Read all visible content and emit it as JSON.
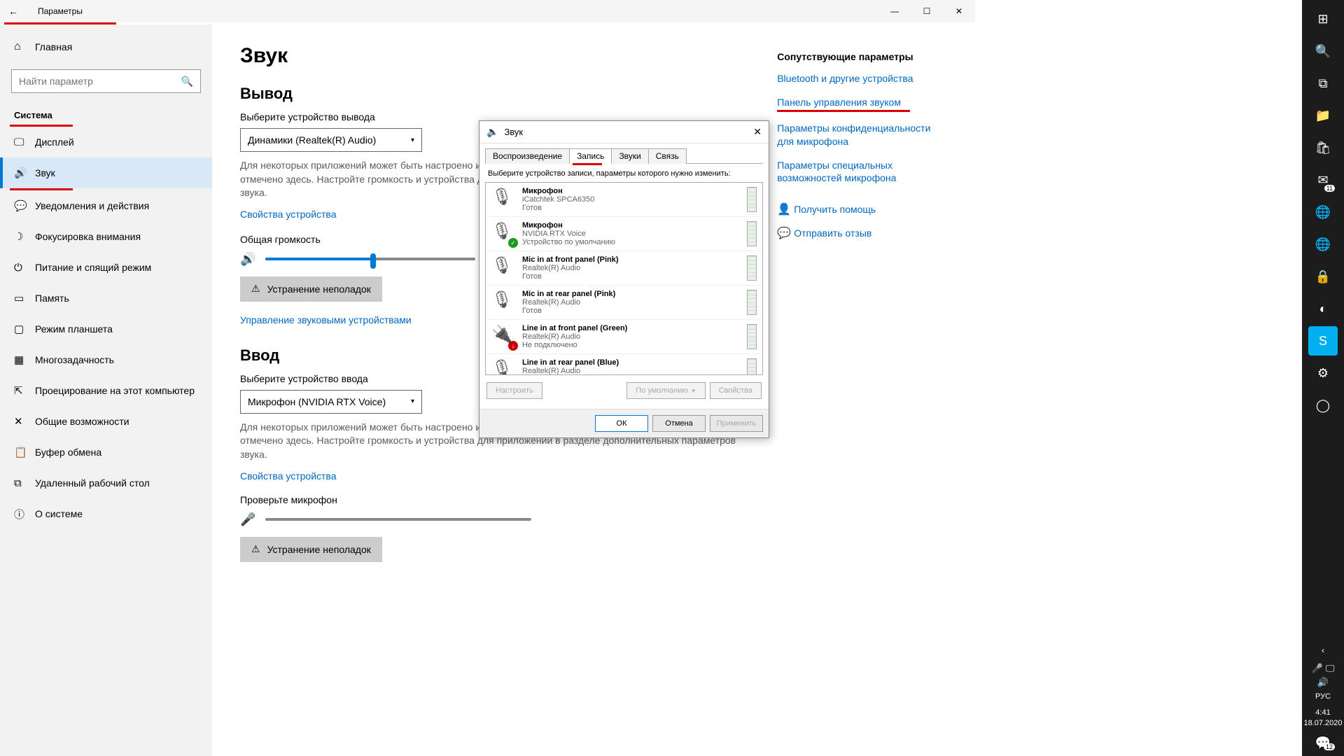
{
  "titlebar": {
    "title": "Параметры"
  },
  "sidebar": {
    "home": "Главная",
    "search_placeholder": "Найти параметр",
    "section": "Система",
    "items": [
      {
        "label": "Дисплей"
      },
      {
        "label": "Звук"
      },
      {
        "label": "Уведомления и действия"
      },
      {
        "label": "Фокусировка внимания"
      },
      {
        "label": "Питание и спящий режим"
      },
      {
        "label": "Память"
      },
      {
        "label": "Режим планшета"
      },
      {
        "label": "Многозадачность"
      },
      {
        "label": "Проецирование на этот компьютер"
      },
      {
        "label": "Общие возможности"
      },
      {
        "label": "Буфер обмена"
      },
      {
        "label": "Удаленный рабочий стол"
      },
      {
        "label": "О системе"
      }
    ]
  },
  "main": {
    "page_title": "Звук",
    "output_h": "Вывод",
    "output_label": "Выберите устройство вывода",
    "output_device": "Динамики (Realtek(R) Audio)",
    "output_desc": "Для некоторых приложений может быть настроено использование не того звукового устройства, которое отмечено здесь. Настройте громкость и устройства для приложений в разделе дополнительных параметров звука.",
    "device_props": "Свойства устройства",
    "volume_label": "Общая громкость",
    "volume_percent": 50,
    "troubleshoot": "Устранение неполадок",
    "manage_devices": "Управление звуковыми устройствами",
    "input_h": "Ввод",
    "input_label": "Выберите устройство ввода",
    "input_device": "Микрофон (NVIDIA RTX Voice)",
    "input_desc": "Для некоторых приложений может быть настроено использование не того звукового устройства, которое отмечено здесь. Настройте громкость и устройства для приложений в разделе дополнительных параметров звука.",
    "test_mic": "Проверьте микрофон"
  },
  "sidepanel": {
    "title": "Сопутствующие параметры",
    "links": [
      "Bluetooth и другие устройства",
      "Панель управления звуком",
      "Параметры конфиденциальности для микрофона",
      "Параметры специальных возможностей микрофона"
    ],
    "help": "Получить помощь",
    "feedback": "Отправить отзыв"
  },
  "dialog": {
    "title": "Звук",
    "tabs": [
      "Воспроизведение",
      "Запись",
      "Звуки",
      "Связь"
    ],
    "active_tab": 1,
    "desc": "Выберите устройство записи, параметры которого нужно изменить:",
    "devices": [
      {
        "name": "Микрофон",
        "sub": "iCatchtek SPCA6350",
        "status": "Готов",
        "badge": ""
      },
      {
        "name": "Микрофон",
        "sub": "NVIDIA RTX Voice",
        "status": "Устройство по умолчанию",
        "badge": "ok"
      },
      {
        "name": "Mic in at front panel (Pink)",
        "sub": "Realtek(R) Audio",
        "status": "Готов",
        "badge": ""
      },
      {
        "name": "Mic in at rear panel (Pink)",
        "sub": "Realtek(R) Audio",
        "status": "Готов",
        "badge": ""
      },
      {
        "name": "Line in at front panel (Green)",
        "sub": "Realtek(R) Audio",
        "status": "Не подключено",
        "badge": "down"
      },
      {
        "name": "Line in at rear panel (Blue)",
        "sub": "Realtek(R) Audio",
        "status": "",
        "badge": ""
      }
    ],
    "btn_configure": "Настроить",
    "btn_default": "По умолчанию",
    "btn_props": "Свойства",
    "btn_ok": "ОК",
    "btn_cancel": "Отмена",
    "btn_apply": "Применить"
  },
  "taskbar": {
    "lang": "РУС",
    "time": "4:41",
    "date": "18.07.2020",
    "mail_badge": "11",
    "notif_badge": "12"
  }
}
